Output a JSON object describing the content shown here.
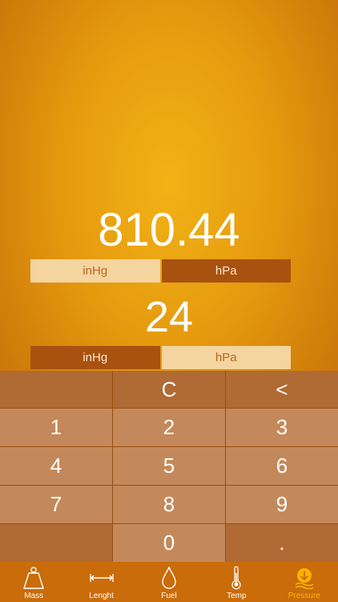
{
  "display": {
    "result_value": "810.44",
    "input_value": "24"
  },
  "output_units": [
    {
      "label": "inHg",
      "selected": true
    },
    {
      "label": "hPa",
      "selected": false
    }
  ],
  "input_units": [
    {
      "label": "inHg",
      "selected": false
    },
    {
      "label": "hPa",
      "selected": true
    }
  ],
  "keypad": {
    "clear": "C",
    "backspace": "<",
    "k1": "1",
    "k2": "2",
    "k3": "3",
    "k4": "4",
    "k5": "5",
    "k6": "6",
    "k7": "7",
    "k8": "8",
    "k9": "9",
    "k0": "0",
    "dot": "."
  },
  "tabs": [
    {
      "label": "Mass",
      "icon": "weight-icon"
    },
    {
      "label": "Lenght",
      "icon": "ruler-icon"
    },
    {
      "label": "Fuel",
      "icon": "drop-icon"
    },
    {
      "label": "Temp",
      "icon": "thermometer-icon"
    },
    {
      "label": "Pressure",
      "icon": "pressure-icon",
      "active": true
    }
  ],
  "colors": {
    "accent": "#ffb300",
    "background": "#e59a0e",
    "tabbar": "#c96c09"
  }
}
